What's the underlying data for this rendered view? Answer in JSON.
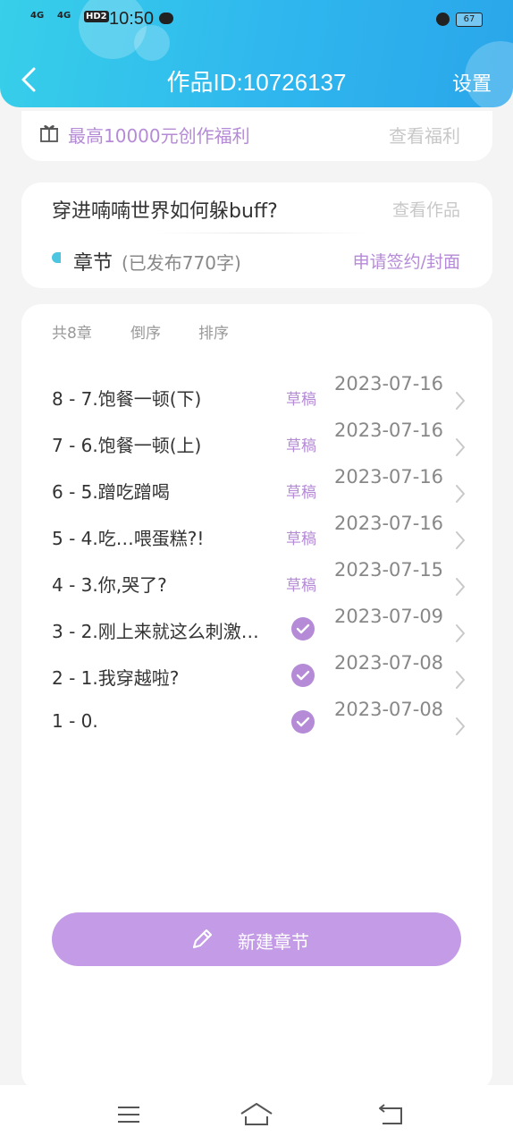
{
  "status_bar": {
    "signal_1": "4G",
    "signal_2": "4G",
    "hd": "HD2",
    "time": "10:50",
    "battery": "67"
  },
  "header": {
    "title": "作品ID:10726137",
    "settings_label": "设置"
  },
  "promo": {
    "text": "最高10000元创作福利",
    "link": "查看福利"
  },
  "book": {
    "title": "穿进喃喃世界如何躲buff?",
    "view_link": "查看作品",
    "chapters_label": "章节",
    "published_count": "(已发布770字)",
    "apply_link": "申请签约/封面"
  },
  "chapter_list": {
    "total": "共8章",
    "reverse_label": "倒序",
    "sort_label": "排序",
    "rows": [
      {
        "title": "8 - 7.饱餐一顿(下)",
        "status": "草稿",
        "date": "2023-07-16"
      },
      {
        "title": "7 - 6.饱餐一顿(上)",
        "status": "草稿",
        "date": "2023-07-16"
      },
      {
        "title": "6 - 5.蹭吃蹭喝",
        "status": "草稿",
        "date": "2023-07-16"
      },
      {
        "title": "5 - 4.吃…喂蛋糕?!",
        "status": "草稿",
        "date": "2023-07-16"
      },
      {
        "title": "4 - 3.你,哭了?",
        "status": "草稿",
        "date": "2023-07-15"
      },
      {
        "title": "3 - 2.刚上来就这么刺激…",
        "status": "",
        "date": "2023-07-09"
      },
      {
        "title": "2 - 1.我穿越啦?",
        "status": "",
        "date": "2023-07-08"
      },
      {
        "title": "1 - 0.",
        "status": "",
        "date": "2023-07-08"
      }
    ]
  },
  "new_chapter_button": "新建章节",
  "colors": {
    "header_gradient_start": "#37cfe9",
    "header_gradient_end": "#2aa6ea",
    "accent_purple": "#b58ad6",
    "button_purple": "#c39be6"
  },
  "icons": [
    "back-icon",
    "gift-icon",
    "check-icon",
    "chevron-right-icon",
    "pencil-icon",
    "menu-icon",
    "home-icon",
    "back-nav-icon"
  ]
}
